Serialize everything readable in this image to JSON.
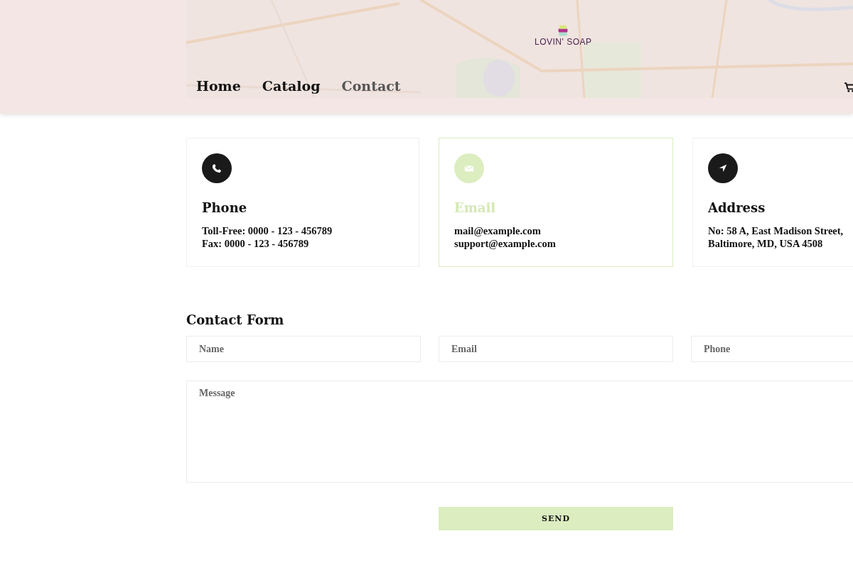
{
  "header": {
    "logo": {
      "name": "LOVIN' SOAP"
    },
    "nav": [
      {
        "label": "Home",
        "selected": false
      },
      {
        "label": "Catalog",
        "selected": false
      },
      {
        "label": "Contact",
        "selected": true
      }
    ]
  },
  "info_cards": [
    {
      "kind": "phone",
      "title": "Phone",
      "lines": [
        "Toll-Free: 0000 - 123 - 456789",
        "Fax: 0000 - 123 - 456789"
      ],
      "highlighted": false
    },
    {
      "kind": "email",
      "title": "Email",
      "lines": [
        "mail@example.com",
        "support@example.com"
      ],
      "highlighted": true
    },
    {
      "kind": "address",
      "title": "Address",
      "lines": [
        "No: 58 A, East Madison Street,",
        "Baltimore, MD, USA 4508"
      ],
      "highlighted": false
    }
  ],
  "contact_form": {
    "title": "Contact Form",
    "fields": [
      {
        "placeholder": "Name"
      },
      {
        "placeholder": "Email"
      },
      {
        "placeholder": "Phone"
      }
    ],
    "message": {
      "placeholder": "Message"
    },
    "send_button": "SEND"
  }
}
